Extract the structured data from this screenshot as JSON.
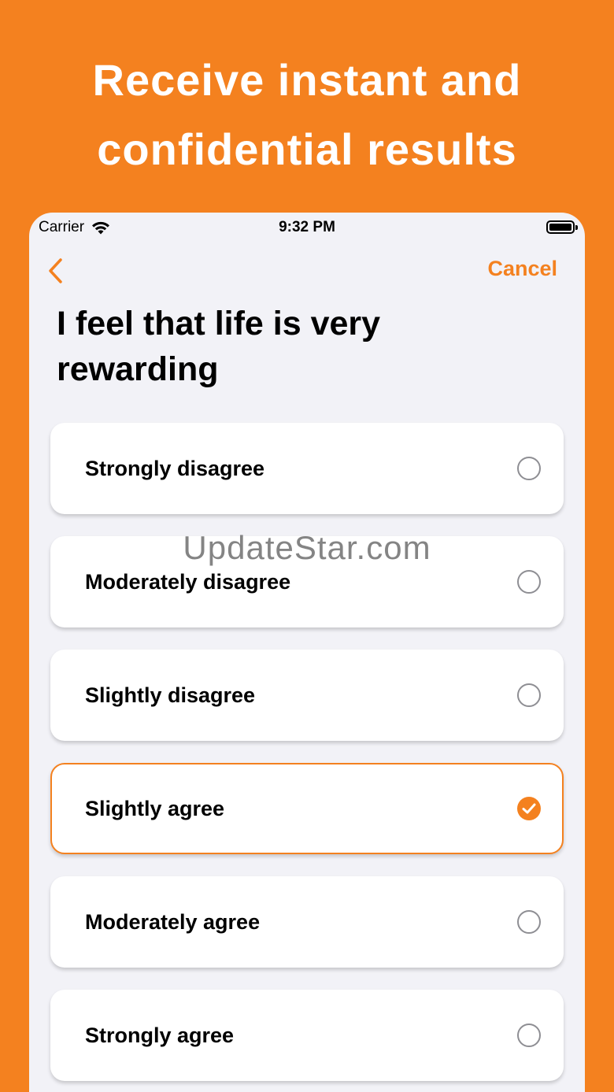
{
  "promo": {
    "headline_line1": "Receive instant and",
    "headline_line2": "confidential results"
  },
  "status_bar": {
    "carrier": "Carrier",
    "time": "9:32 PM"
  },
  "nav": {
    "cancel_label": "Cancel"
  },
  "question": {
    "text": "I feel that life is very rewarding"
  },
  "options": [
    {
      "label": "Strongly disagree",
      "selected": false
    },
    {
      "label": "Moderately disagree",
      "selected": false
    },
    {
      "label": "Slightly disagree",
      "selected": false
    },
    {
      "label": "Slightly agree",
      "selected": true
    },
    {
      "label": "Moderately agree",
      "selected": false
    },
    {
      "label": "Strongly agree",
      "selected": false
    }
  ],
  "watermark": {
    "text": "UpdateStar.com"
  },
  "colors": {
    "accent": "#F4811F",
    "background": "#F2F2F7",
    "card": "#FFFFFF"
  }
}
